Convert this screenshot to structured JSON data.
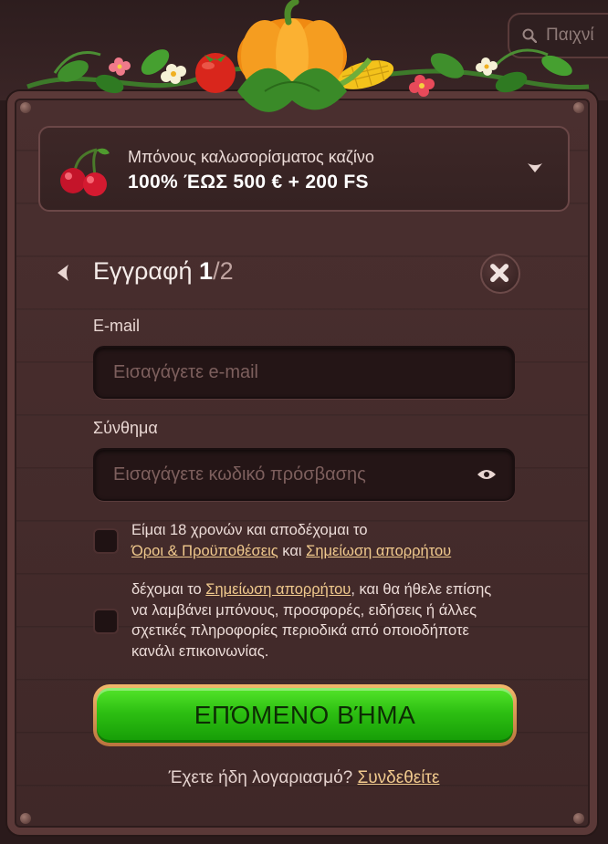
{
  "search": {
    "placeholder": "Παιχνί"
  },
  "bonus": {
    "label": "Μπόνους καλωσορίσματος καζίνο",
    "amount": "100% ΈΩΣ 500 € + 200 FS"
  },
  "header": {
    "title": "Εγγραφή",
    "step_current": "1",
    "step_total": "/2"
  },
  "form": {
    "email_label": "E-mail",
    "email_placeholder": "Εισαγάγετε e-mail",
    "password_label": "Σύνθημα",
    "password_placeholder": "Εισαγάγετε κωδικό πρόσβασης"
  },
  "consent": {
    "age_text": "Είμαι 18 χρονών και αποδέχομαι το",
    "terms_link": "Όροι & Προϋποθέσεις",
    "and": "και",
    "privacy_link": "Σημείωση απορρήτου",
    "marketing_prefix": "δέχομαι το",
    "marketing_privacy_link": "Σημείωση απορρήτου",
    "marketing_line1_rest": ", και θα ήθελε επίσης",
    "marketing_line2": "να λαμβάνει μπόνους, προσφορές, ειδήσεις ή άλλες",
    "marketing_line3": "σχετικές πληροφορίες περιοδικά από οποιοδήποτε",
    "marketing_line4": "κανάλι επικοινωνίας."
  },
  "cta": {
    "label": "ΕΠΌΜΕΝΟ ΒΉΜΑ"
  },
  "login": {
    "question": "Έχετε ήδη λογαριασμό?",
    "link": "Συνδεθείτε"
  },
  "colors": {
    "accent_green": "#2dbf12",
    "link_gold": "#f0c98d",
    "panel_wood": "#4a2f2f"
  },
  "icons": [
    "search-icon",
    "cherry-icon",
    "chevron-down-icon",
    "back-arrow-icon",
    "close-icon",
    "eye-icon",
    "pumpkin-decor"
  ]
}
